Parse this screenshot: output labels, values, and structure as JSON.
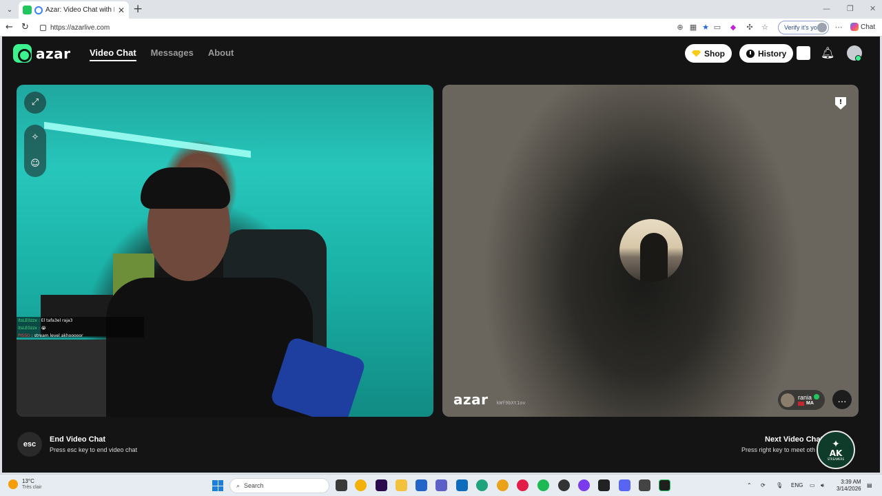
{
  "browser": {
    "tab_title": "Azar: Video Chat with New Pe",
    "url": "https://azarlive.com",
    "verify_label": "Verify it's you",
    "chat_label": "Chat"
  },
  "header": {
    "logo": "azar",
    "nav": [
      {
        "label": "Video Chat",
        "active": true
      },
      {
        "label": "Messages",
        "active": false
      },
      {
        "label": "About",
        "active": false
      }
    ],
    "shop_label": "Shop",
    "history_label": "History"
  },
  "local_video": {
    "chat_messages": [
      {
        "user": "itsLE0zzx :",
        "text": "El tafa3el raja3"
      },
      {
        "user": "itsLE0zzx :",
        "text": "😭"
      },
      {
        "user": "PISSO",
        "text": ": stream level akhooooor"
      }
    ]
  },
  "remote_video": {
    "watermark_logo": "azar",
    "watermark_id": "kWf9bXt1ov",
    "partner_name": "rania",
    "partner_country": "MA"
  },
  "footer": {
    "esc_key": "esc",
    "end_title": "End Video Chat",
    "end_sub": "Press esc key to end video chat",
    "next_title": "Next Video Chat",
    "next_sub": "Press right key to meet oth",
    "badge_text": "AK",
    "badge_sub": "STREAMERS"
  },
  "taskbar": {
    "temperature": "13°C",
    "weather_desc": "Très clair",
    "search_placeholder": "Search",
    "language": "ENG",
    "time": "3:39 AM",
    "date": "3/14/2026"
  },
  "colors": {
    "accent": "#3bf28e",
    "page_bg": "#141414"
  }
}
